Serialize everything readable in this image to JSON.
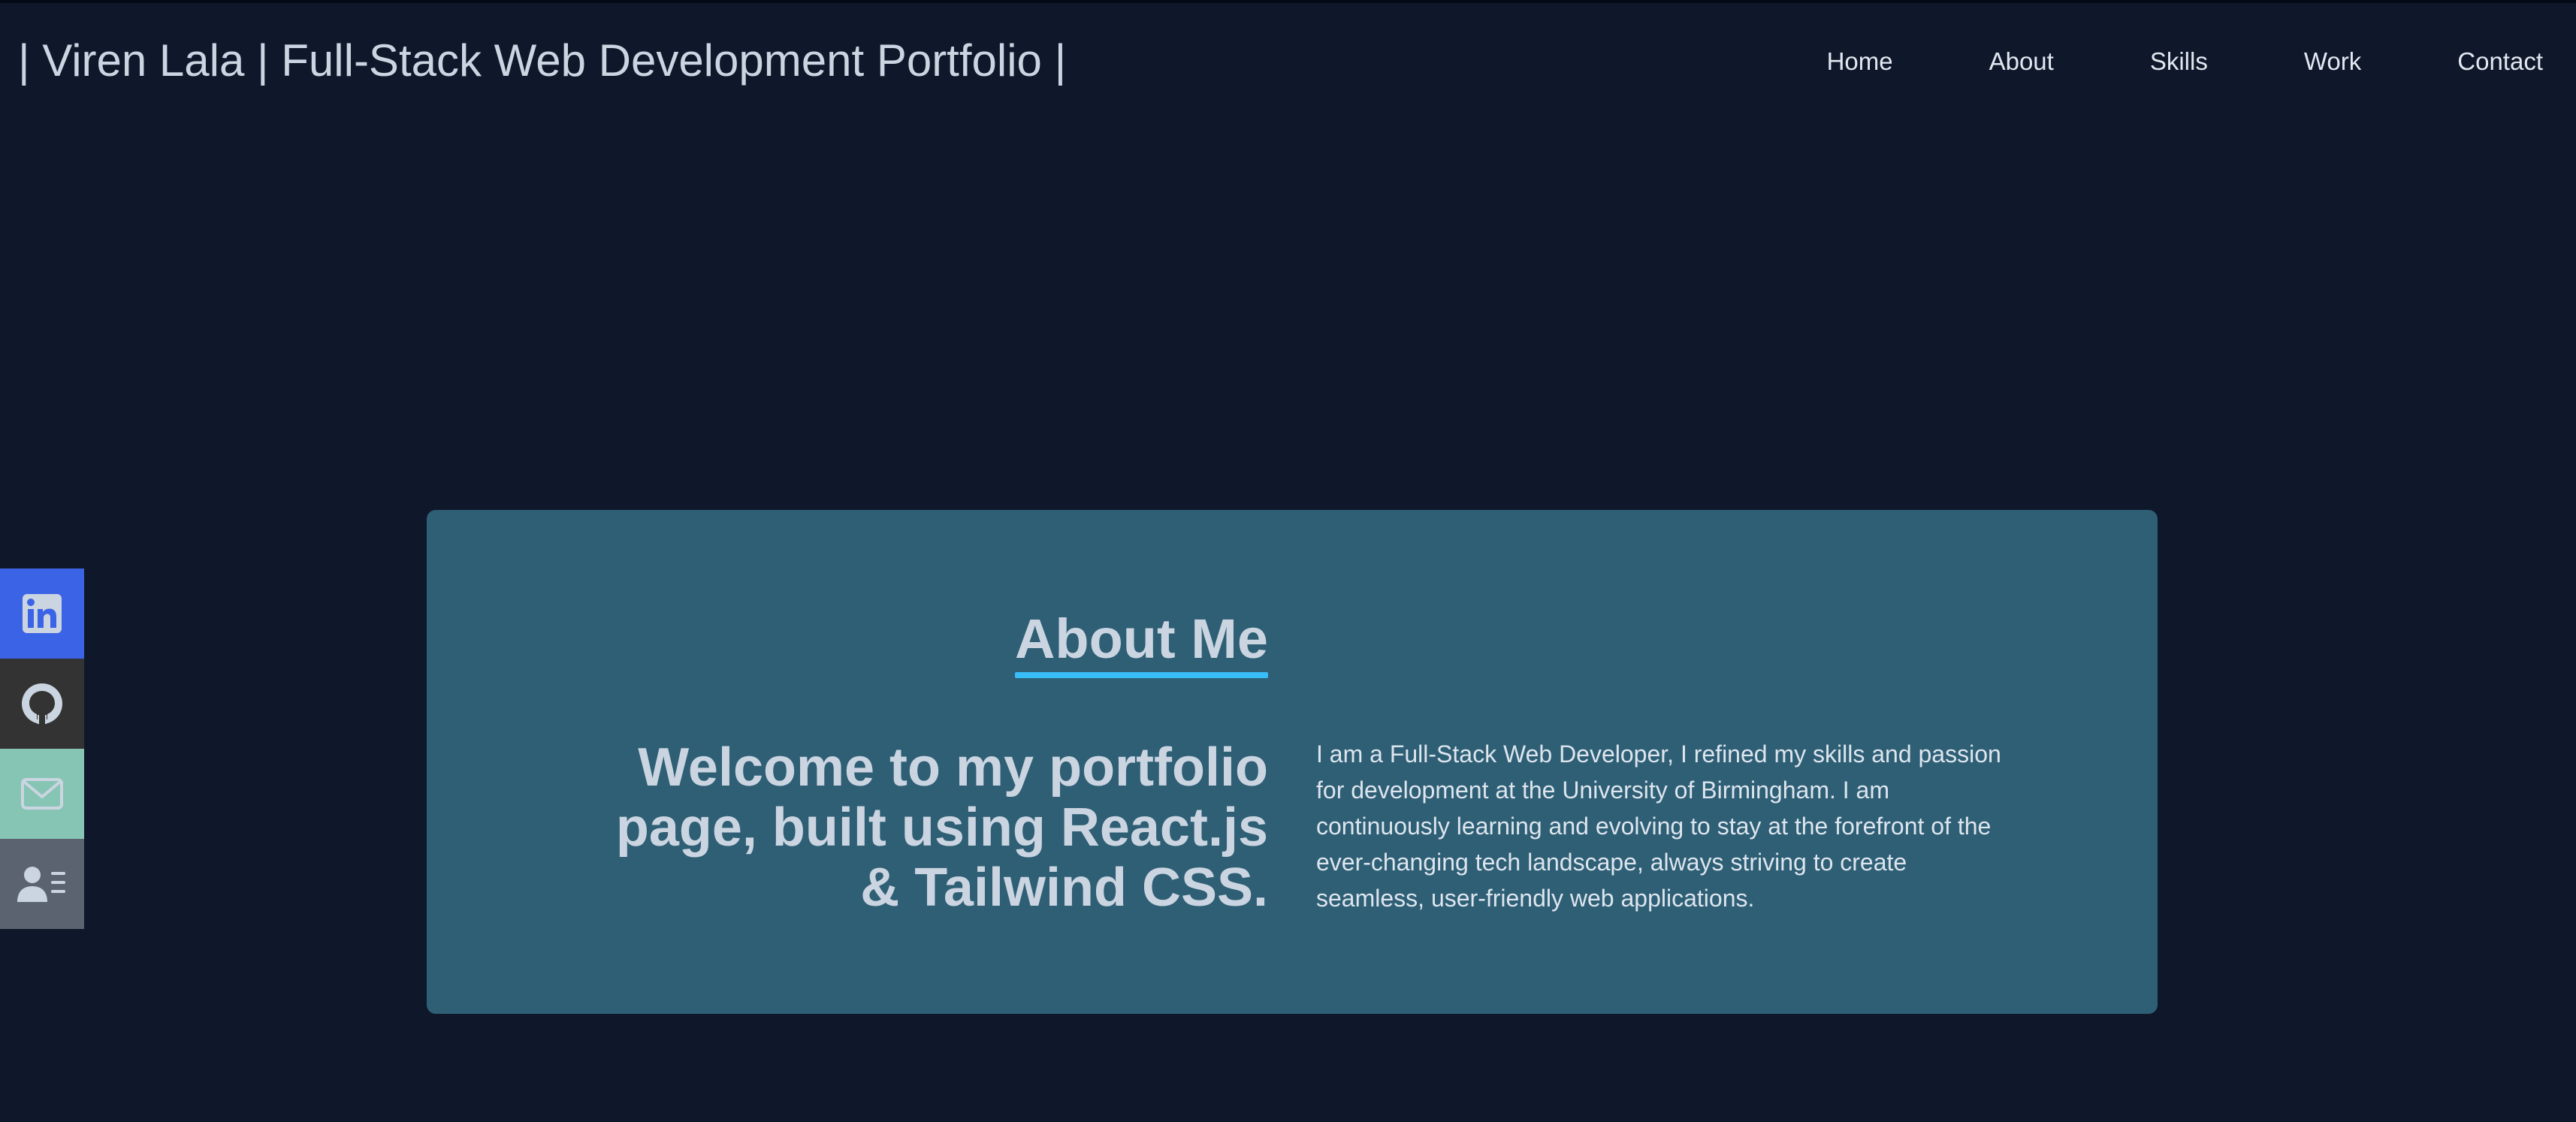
{
  "header": {
    "brand": "| Viren Lala | Full-Stack Web Development Portfolio |",
    "nav": [
      {
        "label": "Home"
      },
      {
        "label": "About"
      },
      {
        "label": "Skills"
      },
      {
        "label": "Work"
      },
      {
        "label": "Contact"
      }
    ]
  },
  "social_sidebar": {
    "items": [
      {
        "icon": "linkedin-icon",
        "color": "#3b63e6"
      },
      {
        "icon": "github-icon",
        "color": "#333333"
      },
      {
        "icon": "mail-icon",
        "color": "#86c5b4"
      },
      {
        "icon": "resume-icon",
        "color": "#5b6370"
      }
    ]
  },
  "about": {
    "title": "About Me",
    "welcome": "Welcome to my portfolio page, built using React.js & Tailwind CSS.",
    "description": "I am a Full-Stack Web Developer, I refined my skills and passion for development at the University of Birmingham. I am continuously learning and evolving to stay at the forefront of the ever-changing tech landscape, always striving to create seamless, user-friendly web applications."
  },
  "colors": {
    "background": "#0f172a",
    "card": "#2e5f75",
    "accent": "#38bdf8"
  }
}
